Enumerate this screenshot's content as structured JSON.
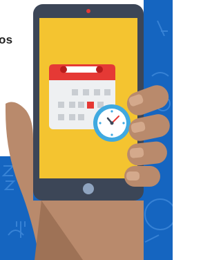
{
  "banner": {
    "heading_fragment": "os"
  },
  "colors": {
    "background_top": "#ffffff",
    "pattern_blue": "#1565c0",
    "phone_body": "#3c4657",
    "phone_screen": "#f4c430",
    "calendar_header": "#e53935",
    "calendar_card": "#eef0f2",
    "highlight_day": "#e53935",
    "clock_ring": "#3fa9e0",
    "hand_skin": "#b98a6c",
    "hand_shadow": "#9e7256"
  },
  "icons": {
    "phone": "smartphone-icon",
    "calendar": "calendar-icon",
    "clock": "clock-icon",
    "hand": "hand-icon",
    "home_button": "home-button-icon",
    "camera": "camera-dot-icon"
  }
}
